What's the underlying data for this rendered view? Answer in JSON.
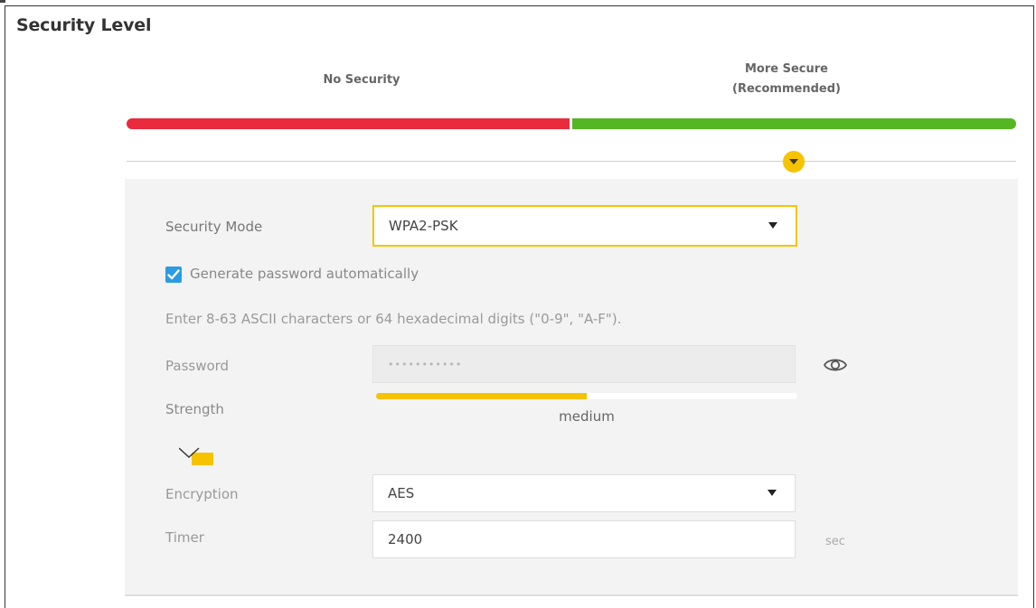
{
  "section": {
    "title": "Security Level"
  },
  "security_level": {
    "options": [
      {
        "label": "No Security"
      },
      {
        "label_line1": "More Secure",
        "label_line2": "(Recommended)"
      }
    ],
    "selected": "More Secure (Recommended)",
    "colors": {
      "no_security": "#ea2a3d",
      "more_secure": "#55b624",
      "marker": "#f6c300"
    }
  },
  "form": {
    "security_mode": {
      "label": "Security Mode",
      "value": "WPA2-PSK"
    },
    "generate_password": {
      "label": "Generate password automatically",
      "checked": true
    },
    "hint": "Enter 8-63 ASCII characters or 64 hexadecimal digits (\"0-9\", \"A-F\").",
    "password": {
      "label": "Password",
      "value": "•••••••••••"
    },
    "strength": {
      "label": "Strength",
      "value_text": "medium",
      "fraction": 0.5
    },
    "encryption": {
      "label": "Encryption",
      "value": "AES"
    },
    "timer": {
      "label": "Timer",
      "value": "2400",
      "unit": "sec"
    }
  },
  "icons": {
    "marker": "chevron-down-icon",
    "show_password": "eye-icon",
    "check": "checkmark-icon",
    "advanced": "chevron-down-icon",
    "dropdown": "caret-down-icon"
  }
}
